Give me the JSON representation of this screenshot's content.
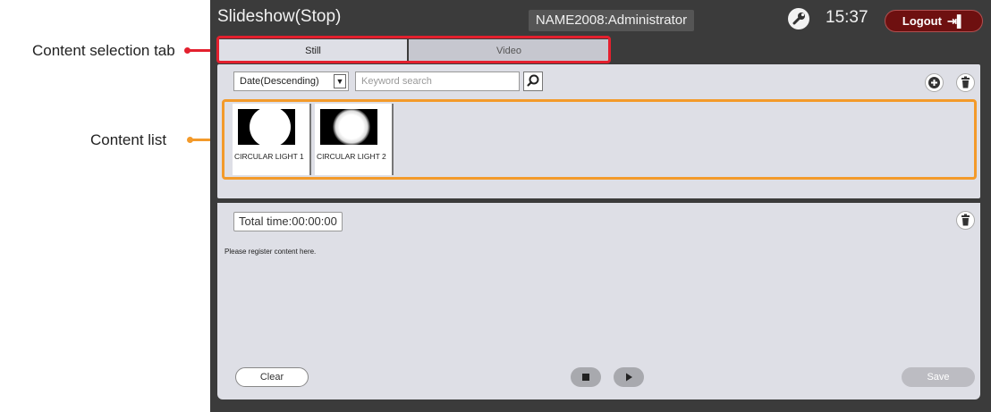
{
  "annotations": {
    "content_selection_tab": "Content selection tab",
    "content_list": "Content list",
    "colors": {
      "tab_box": "#e3202e",
      "list_box": "#f39a2a"
    }
  },
  "header": {
    "title": "Slideshow(Stop)",
    "user": "NAME2008:Administrator",
    "time": "15:37",
    "logout_label": "Logout",
    "settings_icon": "wrench-icon",
    "logout_icon": "exit-door-icon"
  },
  "tabs": [
    {
      "label": "Still",
      "selected": true
    },
    {
      "label": "Video",
      "selected": false
    }
  ],
  "content_panel": {
    "sort_value": "Date(Descending)",
    "search_placeholder": "Keyword search",
    "search_icon": "magnifier-icon",
    "add_icon": "plus-circle-icon",
    "delete_icon": "trash-icon",
    "items": [
      {
        "label": "CIRCULAR LIGHT 1",
        "thumbnail": "hard-edged white circle on black"
      },
      {
        "label": "CIRCULAR LIGHT 2",
        "thumbnail": "soft-edged white circle on black"
      }
    ]
  },
  "slideshow_panel": {
    "total_time": "Total time:00:00:00",
    "hint": "Please register content here.",
    "delete_icon": "trash-icon",
    "clear_label": "Clear",
    "stop_icon": "stop-icon",
    "play_icon": "play-icon",
    "save_label": "Save"
  }
}
